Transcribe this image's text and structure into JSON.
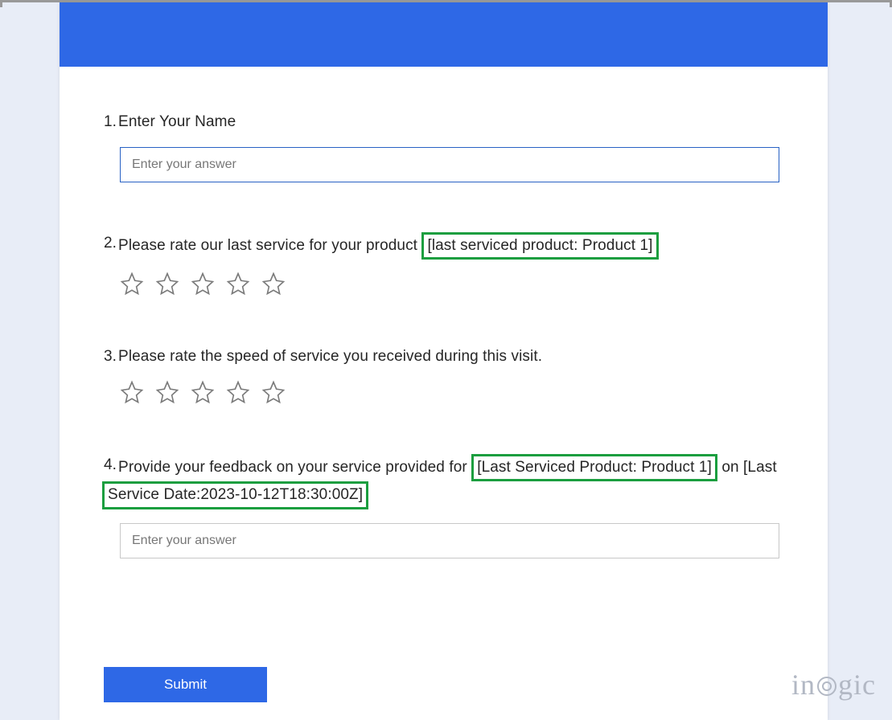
{
  "questions": {
    "q1": {
      "number": "1.",
      "text": "Enter Your Name",
      "placeholder": "Enter your answer"
    },
    "q2": {
      "number": "2.",
      "text_before": "Please rate our last service for your product ",
      "highlight": "[last serviced product: Product 1]"
    },
    "q3": {
      "number": "3.",
      "text": "Please rate the speed of service you received during this visit."
    },
    "q4": {
      "number": "4.",
      "text_before": "Provide your feedback on your service provided for",
      "highlight1": "[Last Serviced Product: Product 1]",
      "text_mid": "on [Last",
      "highlight2": "Service Date:2023-10-12T18:30:00Z]",
      "placeholder": "Enter your answer"
    }
  },
  "submit_label": "Submit",
  "watermark": {
    "part1": "in",
    "part2": "gic"
  }
}
